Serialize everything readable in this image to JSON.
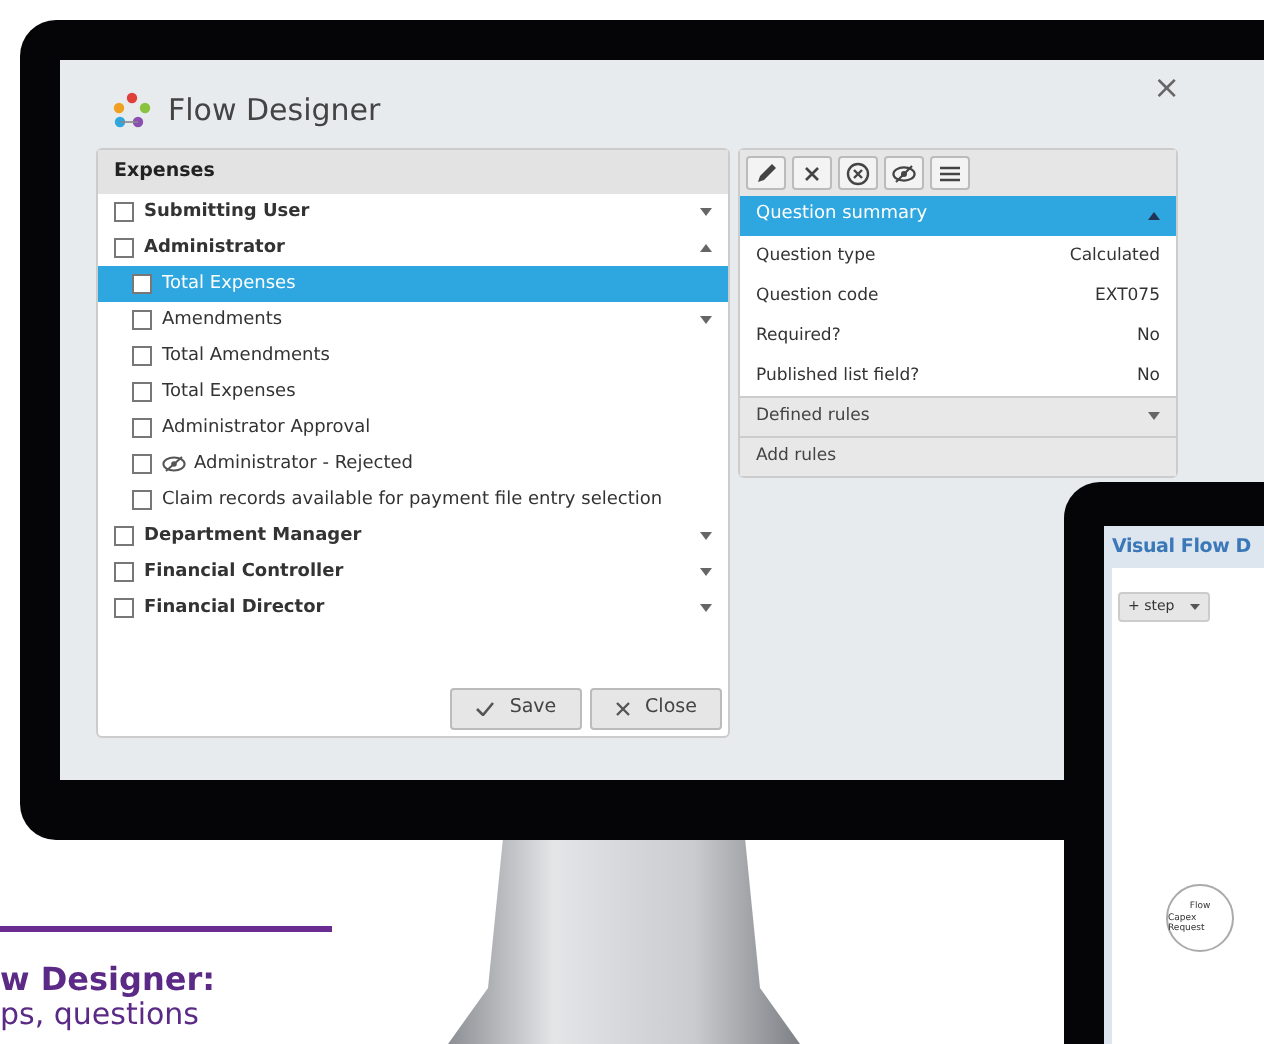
{
  "window": {
    "title": "Flow Designer",
    "close": "×"
  },
  "left_panel": {
    "title": "Expenses",
    "tree": [
      {
        "label": "Submitting User",
        "checked": false,
        "selected": false,
        "expanded": false
      },
      {
        "label": "Administrator",
        "checked": false,
        "selected": false,
        "expanded": true,
        "children": [
          {
            "label": "Total Expenses",
            "checked": false,
            "selected": true
          },
          {
            "label": "Amendments",
            "checked": false,
            "selected": false,
            "expanded": false
          },
          {
            "label": "Total Amendments",
            "checked": false,
            "selected": false
          },
          {
            "label": "Total Expenses",
            "checked": false,
            "selected": false
          },
          {
            "label": "Administrator Approval",
            "checked": false,
            "selected": false
          },
          {
            "label": "Administrator - Rejected",
            "checked": false,
            "selected": false,
            "hidden": true
          },
          {
            "label": "Claim records available for payment file entry selection",
            "checked": false,
            "selected": false
          }
        ]
      },
      {
        "label": "Department Manager",
        "checked": false,
        "selected": false,
        "expanded": false
      },
      {
        "label": "Financial Controller",
        "checked": false,
        "selected": false,
        "expanded": false
      },
      {
        "label": "Financial Director",
        "checked": false,
        "selected": false,
        "expanded": false
      }
    ],
    "buttons": [
      {
        "kind": "save",
        "label": "Save"
      },
      {
        "kind": "close",
        "label": "Close"
      }
    ]
  },
  "right_panel": {
    "summary": {
      "title": "Question summary",
      "expanded": true,
      "rows": [
        {
          "label": "Question type",
          "value": "Calculated"
        },
        {
          "label": "Question code",
          "value": "EXT075"
        },
        {
          "label": "Required?",
          "value": "No"
        },
        {
          "label": "Published list field?",
          "value": "No"
        }
      ]
    },
    "sections": [
      {
        "label": "Defined rules",
        "expanded": false
      },
      {
        "label": "Add rules"
      }
    ]
  },
  "tablet": {
    "title": "Visual Flow D",
    "step_button": "+ step",
    "node": [
      "Flow",
      "Capex Request"
    ]
  },
  "caption": {
    "heading": "w Designer:",
    "text": "ps, questions"
  }
}
